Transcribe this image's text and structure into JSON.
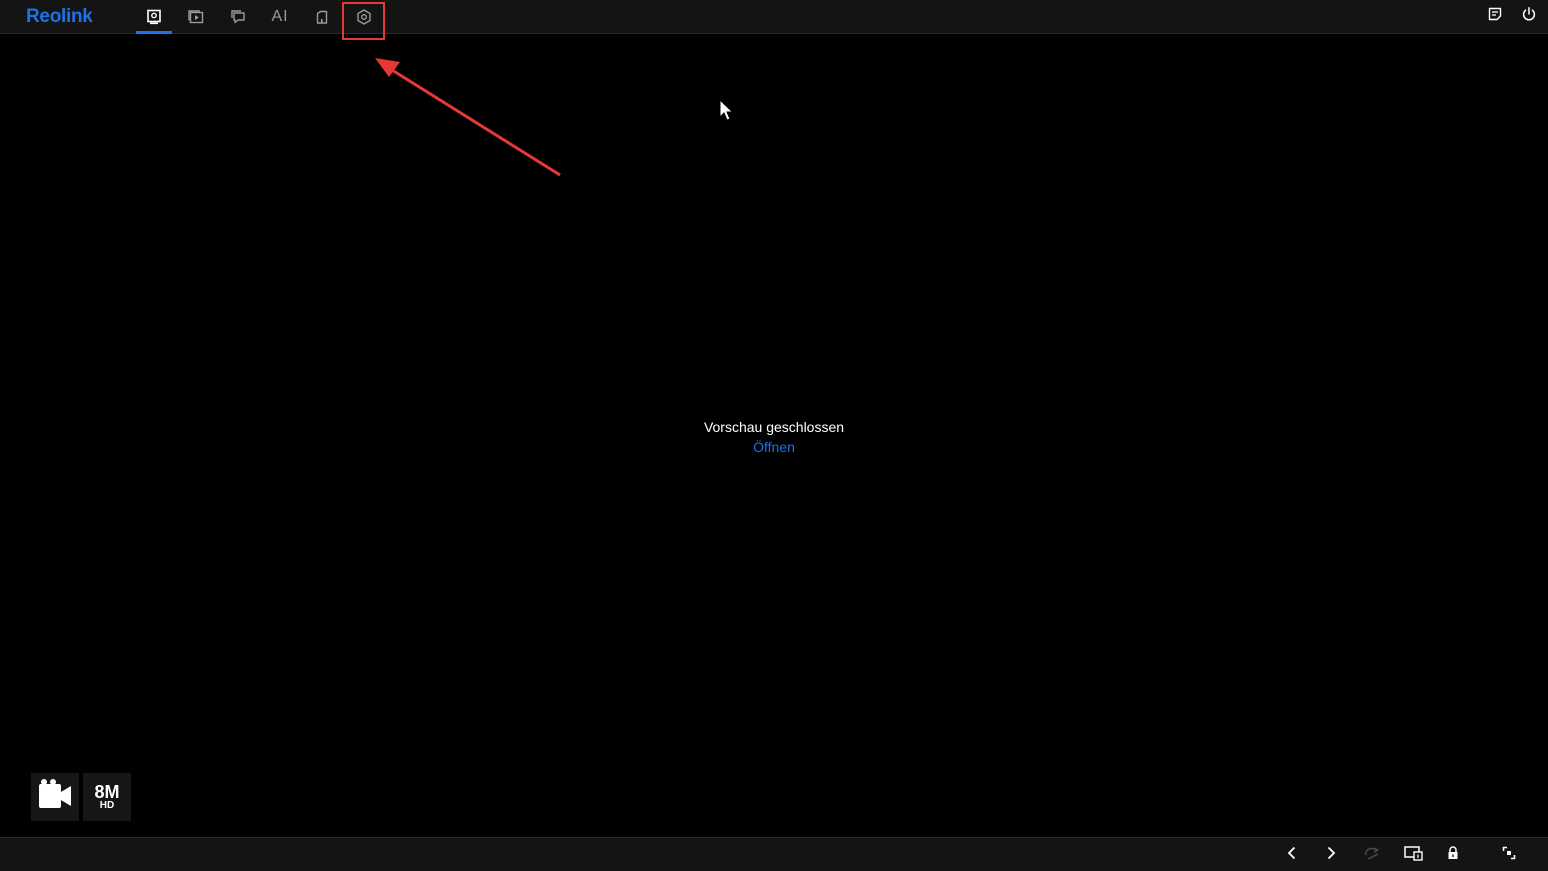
{
  "brand": {
    "name": "Reolink",
    "color": "#1a73e8"
  },
  "nav": {
    "items": [
      {
        "id": "live-view",
        "icon": "live-view-icon",
        "active": true
      },
      {
        "id": "playback",
        "icon": "playback-icon",
        "active": false
      },
      {
        "id": "messages",
        "icon": "chat-icon",
        "active": false
      },
      {
        "id": "ai",
        "label": "AI",
        "active": false
      },
      {
        "id": "device",
        "icon": "device-icon",
        "active": false
      },
      {
        "id": "settings",
        "icon": "settings-gear-icon",
        "active": false,
        "highlighted": true
      }
    ]
  },
  "top_right": {
    "icons": [
      "notes-icon",
      "power-icon"
    ]
  },
  "preview": {
    "message": "Vorschau geschlossen",
    "action": "Öffnen"
  },
  "badges": {
    "camera_icon": "video-camera-icon",
    "resolution_main": "8M",
    "resolution_sub": "HD"
  },
  "bottom_bar": {
    "icons": [
      "chevron-left-icon",
      "chevron-right-icon",
      "rotate-icon",
      "screen-layout-icon",
      "lock-icon",
      "fullscreen-icon"
    ]
  },
  "colors": {
    "background": "#000000",
    "bar": "#141414",
    "accent": "#1a73e8",
    "annotation": "#e53935"
  }
}
